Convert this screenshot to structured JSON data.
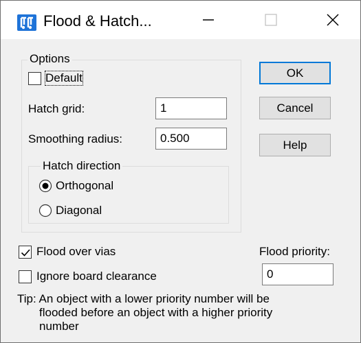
{
  "window": {
    "title": "Flood & Hatch...",
    "icon": "flood-hatch-app-icon",
    "controls": [
      "minimize",
      "maximize",
      "close"
    ]
  },
  "options_group": {
    "caption": "Options",
    "default_checkbox": {
      "label": "Default",
      "checked": false
    },
    "hatch_grid": {
      "label": "Hatch grid:",
      "value": "1"
    },
    "smoothing_radius": {
      "label": "Smoothing radius:",
      "value": "0.500"
    },
    "hatch_direction": {
      "caption": "Hatch direction",
      "options": [
        {
          "label": "Orthogonal",
          "selected": true
        },
        {
          "label": "Diagonal",
          "selected": false
        }
      ]
    }
  },
  "buttons": {
    "ok": "OK",
    "cancel": "Cancel",
    "help": "Help"
  },
  "flood_over_vias": {
    "label": "Flood over vias",
    "checked": true
  },
  "ignore_board_clearance": {
    "label": "Ignore board clearance",
    "checked": false
  },
  "flood_priority": {
    "label": "Flood priority:",
    "value": "0"
  },
  "tip": {
    "line1": "Tip: An object with a lower priority number will be",
    "line2": "flooded before an object with a higher priority",
    "line3": "number"
  },
  "colors": {
    "accent": "#0078d7",
    "icon_blue": "#1e73d8",
    "dialog_bg": "#f0f0f0"
  }
}
